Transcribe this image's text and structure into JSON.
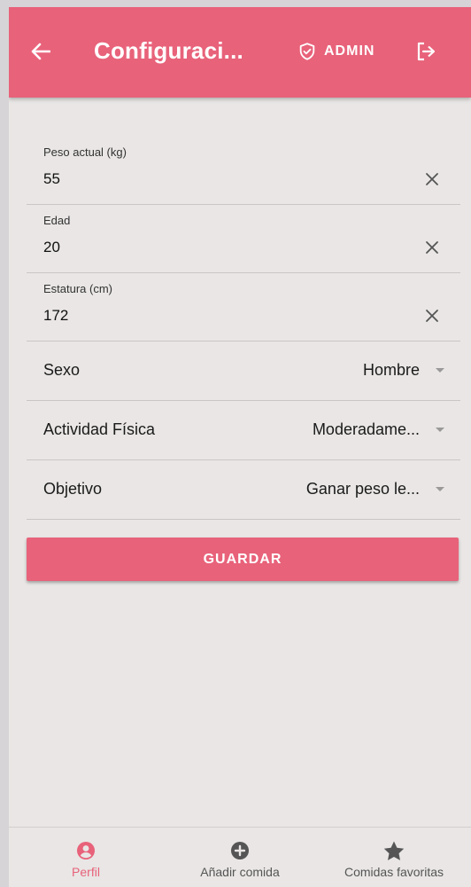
{
  "colors": {
    "primary": "#e8627a",
    "background": "#e9e6e5",
    "icon_grey": "#555555"
  },
  "appbar": {
    "back_icon": "arrow-left-icon",
    "title": "Configuraci...",
    "admin_icon": "shield-check-icon",
    "admin_label": "ADMIN",
    "logout_icon": "logout-icon"
  },
  "form": {
    "fields": [
      {
        "label": "Peso actual (kg)",
        "value": "55"
      },
      {
        "label": "Edad",
        "value": "20"
      },
      {
        "label": "Estatura (cm)",
        "value": "172"
      }
    ],
    "selects": [
      {
        "label": "Sexo",
        "value": "Hombre"
      },
      {
        "label": "Actividad Física",
        "value": "Moderadame..."
      },
      {
        "label": "Objetivo",
        "value": "Ganar peso le..."
      }
    ],
    "save_label": "GUARDAR"
  },
  "bottom_nav": [
    {
      "label": "Perfil",
      "icon": "account-circle-icon",
      "active": true
    },
    {
      "label": "Añadir comida",
      "icon": "plus-circle-icon",
      "active": false
    },
    {
      "label": "Comidas favoritas",
      "icon": "star-icon",
      "active": false
    }
  ]
}
